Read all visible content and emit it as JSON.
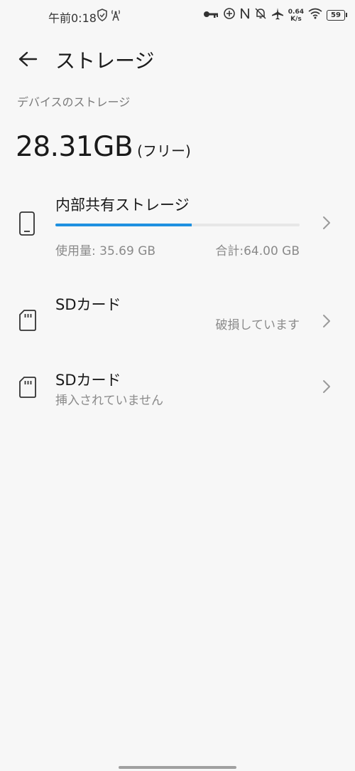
{
  "status_bar": {
    "time": "午前0:18",
    "net_speed_value": "0.64",
    "net_speed_unit": "K/s",
    "battery": "59"
  },
  "app_bar": {
    "title": "ストレージ"
  },
  "device_storage": {
    "section_label": "デバイスのストレージ",
    "free_value": "28.31GB",
    "free_suffix": "(フリー)"
  },
  "internal": {
    "title": "内部共有ストレージ",
    "used_label": "使用量: 35.69 GB",
    "total_label": "合計:64.00 GB",
    "used_fraction": 0.5577
  },
  "sd_card_1": {
    "title": "SDカード",
    "status": "破損しています"
  },
  "sd_card_2": {
    "title": "SDカード",
    "status": "挿入されていません"
  },
  "colors": {
    "accent": "#1e90e0",
    "background": "#f7f7f7"
  }
}
